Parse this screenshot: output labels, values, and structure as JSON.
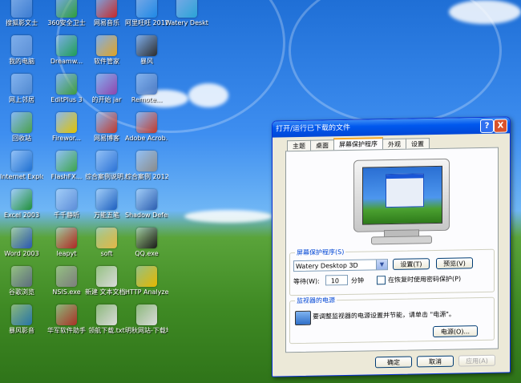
{
  "desktop": {
    "icons": [
      {
        "label": "搜狐影文士",
        "color": "#3b7bd1"
      },
      {
        "label": "360安全卫士",
        "color": "#2e9d3a"
      },
      {
        "label": "网易音乐",
        "color": "#c62828"
      },
      {
        "label": "阿里旺旺 2011",
        "color": "#1e88e5"
      },
      {
        "label": "Watery Desktop 3D",
        "color": "#29a3d6"
      },
      {
        "label": "我的电脑",
        "color": "#5b8fd6"
      },
      {
        "label": "Dreamw...",
        "color": "#1f9d55"
      },
      {
        "label": "软件管家",
        "color": "#e0a323"
      },
      {
        "label": "暴风",
        "color": "#2c2c2c"
      },
      {
        "label": "网上邻居",
        "color": "#4f88d0"
      },
      {
        "label": "EditPlus 3",
        "color": "#3c9b3c"
      },
      {
        "label": "的开始 jar",
        "color": "#8e44ad"
      },
      {
        "label": "Remote...",
        "color": "#4a79c2"
      },
      {
        "label": "回收站",
        "color": "#4aa04a"
      },
      {
        "label": "Firewor...",
        "color": "#e2c200"
      },
      {
        "label": "网易博客",
        "color": "#c0392b"
      },
      {
        "label": "Adobe Acrob...",
        "color": "#c0392b"
      },
      {
        "label": "Internet Explorer",
        "color": "#1e6fd1"
      },
      {
        "label": "FlashFX...",
        "color": "#3ba34c"
      },
      {
        "label": "综合案例说明.html",
        "color": "#2b72d6"
      },
      {
        "label": "综合案例 2012.emp",
        "color": "#8a8a8a"
      },
      {
        "label": "Excel 2003",
        "color": "#1f8f3a"
      },
      {
        "label": "千千静听",
        "color": "#5b8cd9"
      },
      {
        "label": "万能五笔",
        "color": "#1c5fbf"
      },
      {
        "label": "Shadow Defender",
        "color": "#2a5db0"
      },
      {
        "label": "Word 2003",
        "color": "#2b57b5"
      },
      {
        "label": "leapyt",
        "color": "#b02727"
      },
      {
        "label": "soft",
        "color": "#e3b748"
      },
      {
        "label": "QQ.exe",
        "color": "#1a1a1a"
      },
      {
        "label": "谷歌浏览",
        "color": "#5d6d7e"
      },
      {
        "label": "NSIS.exe",
        "color": "#7d7d7d"
      },
      {
        "label": "新建 文本文档.txt",
        "color": "#dcdcdc"
      },
      {
        "label": "HTTP Analyzer",
        "color": "#e6b800"
      },
      {
        "label": "暴风影音",
        "color": "#2874a6"
      },
      {
        "label": "华军软件助手",
        "color": "#a93226"
      },
      {
        "label": "领航下载.txt",
        "color": "#dcdcdc"
      },
      {
        "label": "明秋网站-下载地...",
        "color": "#dcdcdc"
      }
    ]
  },
  "dialog": {
    "title": "打开/运行已下载的文件",
    "help_label": "?",
    "close_label": "X",
    "tabs": [
      {
        "label": "主题",
        "active": false
      },
      {
        "label": "桌面",
        "active": false
      },
      {
        "label": "屏幕保护程序",
        "active": true
      },
      {
        "label": "外观",
        "active": false
      },
      {
        "label": "设置",
        "active": false
      }
    ],
    "screensaver": {
      "group_title": "屏幕保护程序(S)",
      "selected": "Watery Desktop 3D",
      "settings_button": "设置(T)",
      "preview_button": "预览(V)",
      "wait_label": "等待(W):",
      "wait_value": "10",
      "minutes_label": "分钟",
      "password_label": "在恢复时使用密码保护(P)"
    },
    "power": {
      "group_title": "监视器的电源",
      "description": "要调整监视器的电源设置并节能，请单击 \"电源\"。",
      "power_button": "电源(O)..."
    },
    "ok_button": "确定",
    "cancel_button": "取消",
    "apply_button": "应用(A)"
  },
  "colors": {
    "accent": "#0058ee",
    "tab_highlight": "#f5a623",
    "group_title": "#0046d5"
  }
}
